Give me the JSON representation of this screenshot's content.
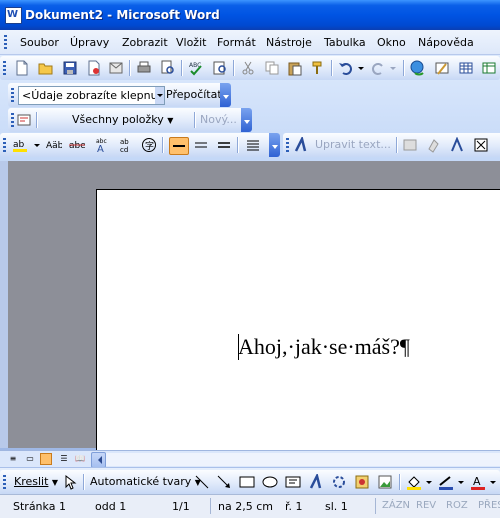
{
  "window": {
    "title": "Dokument2 - Microsoft Word"
  },
  "menubar": {
    "items": [
      "Soubor",
      "Úpravy",
      "Zobrazit",
      "Vložit",
      "Formát",
      "Nástroje",
      "Tabulka",
      "Okno",
      "Nápověda"
    ]
  },
  "toolbar_field": {
    "value": "<Údaje zobrazíte klepnutím",
    "button": "Přepočítat"
  },
  "reviewing": {
    "show_label": "Všechny položky",
    "new_label": "Nový..."
  },
  "formatting": {
    "edit_text_label": "Upravit text..."
  },
  "document": {
    "text": "Ahoj,·jak·se·máš?¶"
  },
  "drawing": {
    "draw_label": "Kreslit",
    "autoshapes_label": "Automatické tvary"
  },
  "status": {
    "page": "Stránka 1",
    "section": "odd 1",
    "pages": "1/1",
    "position": "na 2,5 cm",
    "line": "ř. 1",
    "column": "sl. 1",
    "flags": [
      "ZÁZN",
      "REV",
      "ROZ",
      "PŘES"
    ]
  },
  "colors": {
    "titlebar": "#0054e3",
    "toolbar": "#e3ecfb",
    "page_bg": "#ffffff",
    "workspace": "#8d8f98",
    "active_button": "#ffc06b"
  },
  "icons": {
    "standard": [
      "new-doc-icon",
      "open-icon",
      "save-icon",
      "permission-icon",
      "email-icon",
      "print-icon",
      "print-preview-icon",
      "spelling-icon",
      "research-icon",
      "cut-icon",
      "copy-icon",
      "paste-icon",
      "format-painter-icon",
      "undo-icon",
      "redo-icon",
      "hyperlink-icon",
      "tables-borders-icon",
      "insert-table-icon",
      "insert-excel-icon"
    ]
  }
}
